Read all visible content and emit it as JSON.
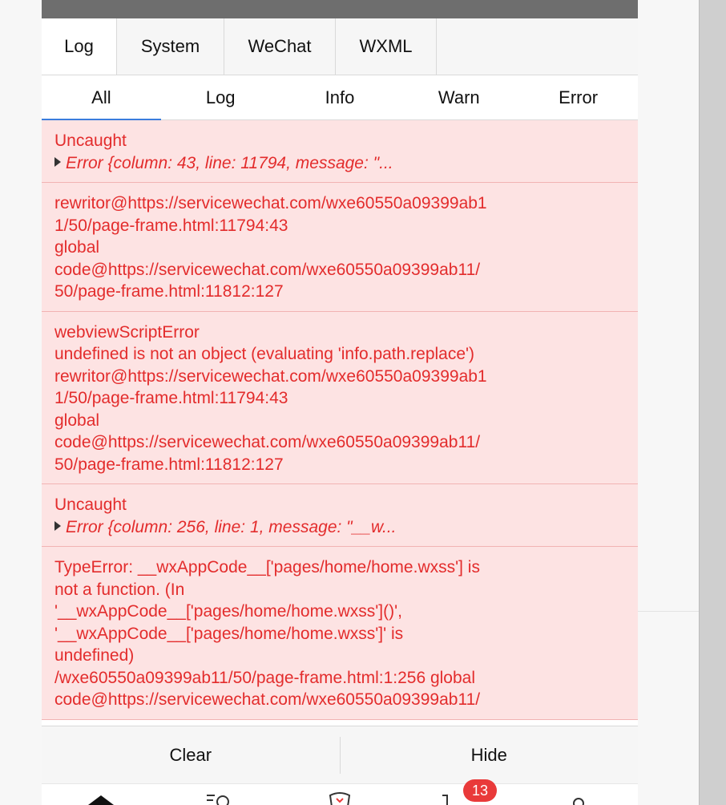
{
  "tabs": [
    {
      "label": "Log",
      "active": true
    },
    {
      "label": "System",
      "active": false
    },
    {
      "label": "WeChat",
      "active": false
    },
    {
      "label": "WXML",
      "active": false
    }
  ],
  "filters": [
    {
      "label": "All",
      "active": true
    },
    {
      "label": "Log",
      "active": false
    },
    {
      "label": "Info",
      "active": false
    },
    {
      "label": "Warn",
      "active": false
    },
    {
      "label": "Error",
      "active": false
    }
  ],
  "log_entries": [
    {
      "lines": [
        "Uncaught"
      ],
      "fold": "Error {column: 43, line: 11794, message: \"..."
    },
    {
      "lines": [
        "rewritor@https://servicewechat.com/wxe60550a09399ab1",
        "1/50/page-frame.html:11794:43",
        "global",
        "code@https://servicewechat.com/wxe60550a09399ab11/",
        "50/page-frame.html:11812:127"
      ]
    },
    {
      "lines": [
        "webviewScriptError",
        "undefined is not an object (evaluating 'info.path.replace')",
        "rewritor@https://servicewechat.com/wxe60550a09399ab1",
        "1/50/page-frame.html:11794:43",
        "global",
        "code@https://servicewechat.com/wxe60550a09399ab11/",
        "50/page-frame.html:11812:127"
      ]
    },
    {
      "lines": [
        "Uncaught"
      ],
      "fold": "Error {column: 256, line: 1, message: \"__w..."
    },
    {
      "lines": [
        "TypeError: __wxAppCode__['pages/home/home.wxss'] is",
        "not a function. (In",
        "'__wxAppCode__['pages/home/home.wxss']()',",
        "'__wxAppCode__['pages/home/home.wxss']' is",
        "undefined)",
        "/wxe60550a09399ab11/50/page-frame.html:1:256 global",
        "code@https://servicewechat.com/wxe60550a09399ab11/"
      ]
    }
  ],
  "footer": {
    "clear_label": "Clear",
    "hide_label": "Hide"
  },
  "tabbar": {
    "badge_count": "13",
    "icons": [
      "home-icon",
      "search-list-icon",
      "shield-icon",
      "cart-icon",
      "profile-icon"
    ]
  },
  "colors": {
    "error_text": "#e32c2c",
    "error_bg": "#fde3e3",
    "badge": "#e93a3a",
    "active_underline": "#3b7ddd"
  }
}
